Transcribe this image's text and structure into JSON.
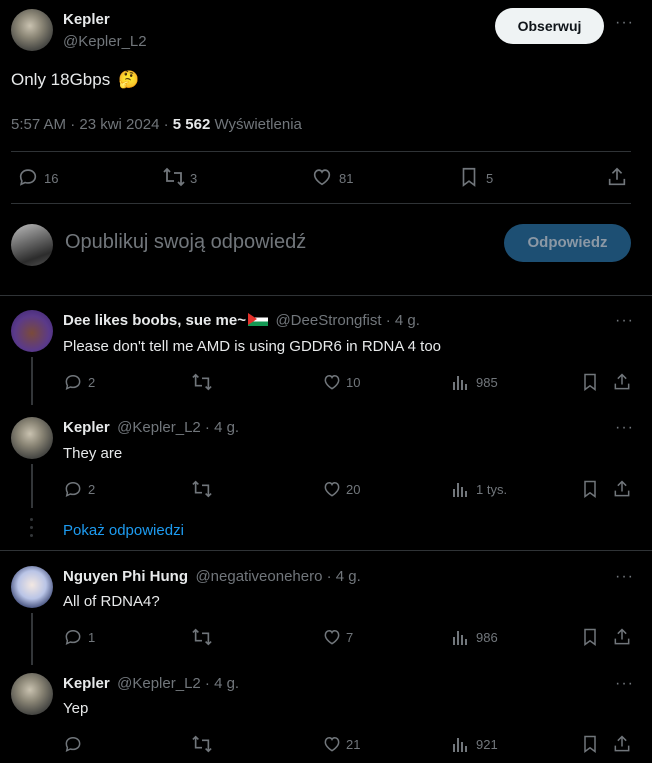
{
  "main_tweet": {
    "author_name": "Kepler",
    "author_handle": "@Kepler_L2",
    "follow_label": "Obserwuj",
    "text": "Only 18Gbps",
    "emoji": "🤔",
    "timestamp": "5:57 AM · 23 kwi 2024 ·",
    "views_count": "5 562",
    "views_label": "Wyświetlenia",
    "replies": "16",
    "reposts": "3",
    "likes": "81",
    "bookmarks": "5"
  },
  "composer": {
    "placeholder": "Opublikuj swoją odpowiedź",
    "reply_button": "Odpowiedz"
  },
  "replies": [
    {
      "name": "Dee likes boobs, sue me~",
      "handle": "@DeeStrongfist · 4 g.",
      "text": "Please don't tell me AMD is using GDDR6 in RDNA 4 too",
      "replies": "2",
      "reposts": "",
      "likes": "10",
      "views": "985"
    },
    {
      "name": "Kepler",
      "handle": "@Kepler_L2 · 4 g.",
      "text": "They are",
      "replies": "2",
      "reposts": "",
      "likes": "20",
      "views": "1 tys."
    },
    {
      "name": "Nguyen Phi Hung",
      "handle": "@negativeonehero · 4 g.",
      "text": "All of RDNA4?",
      "replies": "1",
      "reposts": "",
      "likes": "7",
      "views": "986"
    },
    {
      "name": "Kepler",
      "handle": "@Kepler_L2 · 4 g.",
      "text": "Yep",
      "replies": "",
      "reposts": "",
      "likes": "21",
      "views": "921"
    }
  ],
  "show_replies_label": "Pokaż odpowiedzi",
  "colors": {
    "background": "#000000",
    "text": "#e7e9ea",
    "muted": "#71767b",
    "link": "#1d9bf0",
    "divider": "#2f3336",
    "reply_button_bg": "#1d4f73"
  }
}
